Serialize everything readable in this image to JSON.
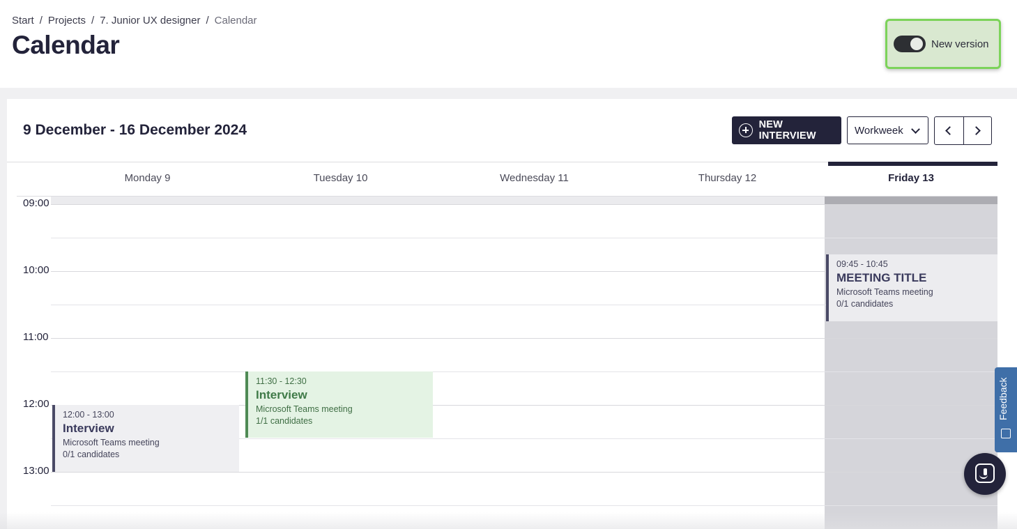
{
  "breadcrumb": {
    "items": [
      "Start",
      "Projects",
      "7. Junior UX designer"
    ],
    "current": "Calendar",
    "separator": "/"
  },
  "page": {
    "title": "Calendar"
  },
  "version_toggle": {
    "label": "New version",
    "enabled": true
  },
  "calendar": {
    "range_title": "9 December - 16 December 2024",
    "new_interview_label": "NEW INTERVIEW",
    "view_select": {
      "selected": "Workweek"
    },
    "days": [
      "Monday 9",
      "Tuesday 10",
      "Wednesday 11",
      "Thursday 12",
      "Friday 13"
    ],
    "today": "Friday 13",
    "times": [
      "09:00",
      "10:00",
      "11:00",
      "12:00",
      "13:00"
    ],
    "events": [
      {
        "time": "12:00 - 13:00",
        "title": "Interview",
        "subtitle": "Microsoft Teams meeting",
        "candidates": "0/1 candidates",
        "day": "Monday 9"
      },
      {
        "time": "11:30 - 12:30",
        "title": "Interview",
        "subtitle": "Microsoft Teams meeting",
        "candidates": "1/1 candidates",
        "day": "Tuesday 10"
      },
      {
        "time": "09:45 - 10:45",
        "title": "MEETING TITLE",
        "subtitle": "Microsoft Teams meeting",
        "candidates": "0/1 candidates",
        "day": "Friday 13"
      }
    ]
  },
  "feedback": {
    "label": "Feedback"
  },
  "icons": {
    "plus": "plus-circle-icon",
    "chevron_down": "chevron-down-icon",
    "prev": "chevron-left-icon",
    "next": "chevron-right-icon",
    "feedback": "feedback-icon",
    "chat": "chat-support-icon"
  },
  "colors": {
    "primary": "#23233a",
    "toggle_highlight": "#7cd35a",
    "green_event": "#e4f3e4",
    "today_column": "#d5d5da",
    "feedback_tab": "#3f6fa8"
  }
}
